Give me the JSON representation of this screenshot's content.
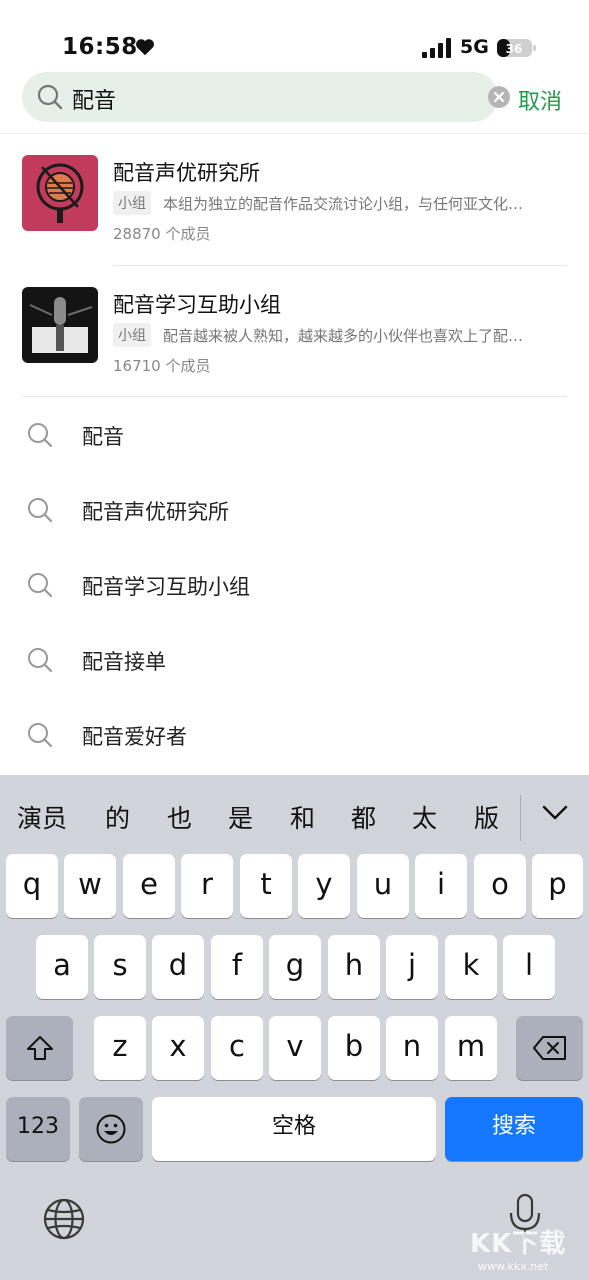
{
  "status_bar": {
    "time": "16:58",
    "network": "5G",
    "battery": "36"
  },
  "search": {
    "query": "配音",
    "cancel_label": "取消"
  },
  "groups": [
    {
      "name": "配音声优研究所",
      "tag": "小组",
      "description": "本组为独立的配音作品交流讨论小组，与任何亚文化…",
      "members": "28870 个成员"
    },
    {
      "name": "配音学习互助小组",
      "tag": "小组",
      "description": "配音越来被人熟知，越来越多的小伙伴也喜欢上了配…",
      "members": "16710 个成员"
    }
  ],
  "suggestions": [
    "配音",
    "配音声优研究所",
    "配音学习互助小组",
    "配音接单",
    "配音爱好者"
  ],
  "keyboard": {
    "candidates": [
      "演员",
      "的",
      "也",
      "是",
      "和",
      "都",
      "太",
      "版"
    ],
    "row1": [
      "q",
      "w",
      "e",
      "r",
      "t",
      "y",
      "u",
      "i",
      "o",
      "p"
    ],
    "row2": [
      "a",
      "s",
      "d",
      "f",
      "g",
      "h",
      "j",
      "k",
      "l"
    ],
    "row3": [
      "z",
      "x",
      "c",
      "v",
      "b",
      "n",
      "m"
    ],
    "num_label": "123",
    "space_label": "空格",
    "search_label": "搜索"
  },
  "watermark": {
    "text": "KK下载",
    "url": "www.kkx.net"
  },
  "colors": {
    "accent_green": "#1f9d4c",
    "keyboard_blue": "#1677ff",
    "search_bg": "#e6efe8"
  }
}
